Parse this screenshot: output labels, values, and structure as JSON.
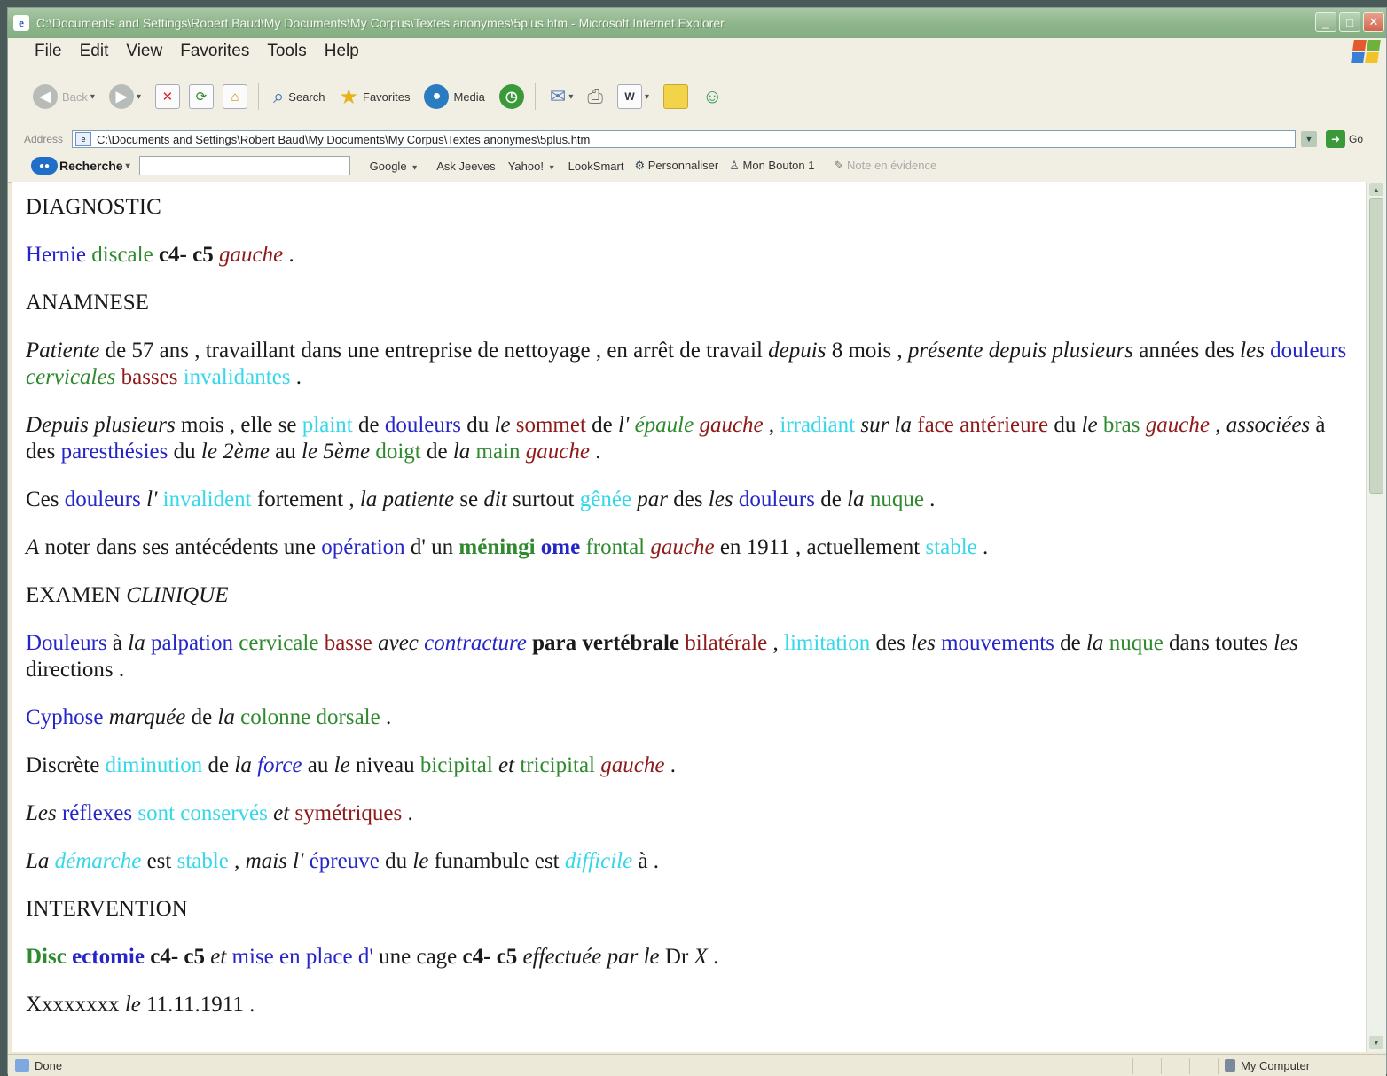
{
  "window": {
    "title": "C:\\Documents and Settings\\Robert Baud\\My Documents\\My Corpus\\Textes anonymes\\5plus.htm - Microsoft Internet Explorer"
  },
  "menu": [
    "File",
    "Edit",
    "View",
    "Favorites",
    "Tools",
    "Help"
  ],
  "toolbar": {
    "back": "Back",
    "search": "Search",
    "favorites": "Favorites",
    "media": "Media"
  },
  "address": {
    "label": "Address",
    "value": "C:\\Documents and Settings\\Robert Baud\\My Documents\\My Corpus\\Textes anonymes\\5plus.htm",
    "go": "Go"
  },
  "links": {
    "search_label": "Recherche",
    "items": [
      "Google",
      "Ask Jeeves",
      "Yahoo!",
      "LookSmart",
      "Personnaliser",
      "Mon Bouton 1",
      "Note en évidence"
    ]
  },
  "status": {
    "left": "Done",
    "zone": "My Computer"
  },
  "colors": {
    "black": "#1a1a1a",
    "blue": "#2626c8",
    "green": "#2f8a2f",
    "red": "#8e1a1a",
    "cyan": "#35d7e8"
  },
  "document": {
    "paragraphs": [
      [
        [
          "DIAGNOSTIC",
          "black",
          ""
        ]
      ],
      [
        [
          "Hernie",
          "blue",
          ""
        ],
        [
          " ",
          "black",
          ""
        ],
        [
          "discale",
          "green",
          ""
        ],
        [
          " ",
          "black",
          ""
        ],
        [
          "c4-",
          "black",
          "b"
        ],
        [
          " ",
          "black",
          ""
        ],
        [
          "c5",
          "black",
          "b"
        ],
        [
          " ",
          "black",
          ""
        ],
        [
          "gauche",
          "red",
          "i"
        ],
        [
          " .",
          "black",
          ""
        ]
      ],
      [
        [
          "ANAMNESE",
          "black",
          ""
        ]
      ],
      [
        [
          "Patiente",
          "black",
          "i"
        ],
        [
          " de 57 ans , travaillant dans une entreprise de nettoyage , en arrêt de travail ",
          "black",
          ""
        ],
        [
          "depuis",
          "black",
          "i"
        ],
        [
          " 8 mois , ",
          "black",
          ""
        ],
        [
          "présente depuis plusieurs",
          "black",
          "i"
        ],
        [
          " années des ",
          "black",
          ""
        ],
        [
          "les",
          "black",
          "i"
        ],
        [
          " ",
          "black",
          ""
        ],
        [
          "douleurs",
          "blue",
          ""
        ],
        [
          " ",
          "black",
          ""
        ],
        [
          "cervicales",
          "green",
          "i"
        ],
        [
          " ",
          "black",
          ""
        ],
        [
          "basses",
          "red",
          ""
        ],
        [
          " ",
          "black",
          ""
        ],
        [
          "invalidantes",
          "cyan",
          ""
        ],
        [
          " .",
          "black",
          ""
        ]
      ],
      [
        [
          "Depuis plusieurs",
          "black",
          "i"
        ],
        [
          " mois , elle se ",
          "black",
          ""
        ],
        [
          "plaint",
          "cyan",
          ""
        ],
        [
          " de ",
          "black",
          ""
        ],
        [
          "douleurs",
          "blue",
          ""
        ],
        [
          " du ",
          "black",
          ""
        ],
        [
          "le",
          "black",
          "i"
        ],
        [
          " ",
          "black",
          ""
        ],
        [
          "sommet",
          "red",
          ""
        ],
        [
          " de ",
          "black",
          ""
        ],
        [
          "l'",
          "black",
          "i"
        ],
        [
          " ",
          "black",
          ""
        ],
        [
          "épaule",
          "green",
          "i"
        ],
        [
          " ",
          "black",
          ""
        ],
        [
          "gauche",
          "red",
          "i"
        ],
        [
          " , ",
          "black",
          ""
        ],
        [
          "irradiant",
          "cyan",
          ""
        ],
        [
          " ",
          "black",
          ""
        ],
        [
          "sur la",
          "black",
          "i"
        ],
        [
          " ",
          "black",
          ""
        ],
        [
          "face",
          "red",
          ""
        ],
        [
          " ",
          "black",
          ""
        ],
        [
          "antérieure",
          "red",
          ""
        ],
        [
          " du ",
          "black",
          ""
        ],
        [
          "le",
          "black",
          "i"
        ],
        [
          " ",
          "black",
          ""
        ],
        [
          "bras",
          "green",
          ""
        ],
        [
          " ",
          "black",
          ""
        ],
        [
          "gauche",
          "red",
          "i"
        ],
        [
          " , ",
          "black",
          ""
        ],
        [
          "associées",
          "black",
          "i"
        ],
        [
          " à des ",
          "black",
          ""
        ],
        [
          "paresthésies",
          "blue",
          ""
        ],
        [
          " du ",
          "black",
          ""
        ],
        [
          "le 2ème",
          "black",
          "i"
        ],
        [
          " au ",
          "black",
          ""
        ],
        [
          "le 5ème",
          "black",
          "i"
        ],
        [
          " ",
          "black",
          ""
        ],
        [
          "doigt",
          "green",
          ""
        ],
        [
          " de ",
          "black",
          ""
        ],
        [
          "la",
          "black",
          "i"
        ],
        [
          " ",
          "black",
          ""
        ],
        [
          "main",
          "green",
          ""
        ],
        [
          " ",
          "black",
          ""
        ],
        [
          "gauche",
          "red",
          "i"
        ],
        [
          " .",
          "black",
          ""
        ]
      ],
      [
        [
          "Ces ",
          "black",
          ""
        ],
        [
          "douleurs",
          "blue",
          ""
        ],
        [
          " ",
          "black",
          ""
        ],
        [
          "l'",
          "black",
          "i"
        ],
        [
          " ",
          "black",
          ""
        ],
        [
          "invalident",
          "cyan",
          ""
        ],
        [
          " fortement , ",
          "black",
          ""
        ],
        [
          "la patiente",
          "black",
          "i"
        ],
        [
          " se ",
          "black",
          ""
        ],
        [
          "dit",
          "black",
          "i"
        ],
        [
          " surtout ",
          "black",
          ""
        ],
        [
          "gênée",
          "cyan",
          ""
        ],
        [
          " ",
          "black",
          ""
        ],
        [
          "par",
          "black",
          "i"
        ],
        [
          " des ",
          "black",
          ""
        ],
        [
          "les",
          "black",
          "i"
        ],
        [
          " ",
          "black",
          ""
        ],
        [
          "douleurs",
          "blue",
          ""
        ],
        [
          " de ",
          "black",
          ""
        ],
        [
          "la",
          "black",
          "i"
        ],
        [
          " ",
          "black",
          ""
        ],
        [
          "nuque",
          "green",
          ""
        ],
        [
          " .",
          "black",
          ""
        ]
      ],
      [
        [
          "A",
          "black",
          "i"
        ],
        [
          " noter dans ses antécédents une ",
          "black",
          ""
        ],
        [
          "opération",
          "blue",
          ""
        ],
        [
          " d' un ",
          "black",
          ""
        ],
        [
          "méningi",
          "green",
          "b"
        ],
        [
          " ",
          "black",
          ""
        ],
        [
          "ome",
          "blue",
          "b"
        ],
        [
          " ",
          "black",
          ""
        ],
        [
          "frontal",
          "green",
          ""
        ],
        [
          " ",
          "black",
          ""
        ],
        [
          "gauche",
          "red",
          "i"
        ],
        [
          " en 1911 , actuellement ",
          "black",
          ""
        ],
        [
          "stable",
          "cyan",
          ""
        ],
        [
          " .",
          "black",
          ""
        ]
      ],
      [
        [
          "EXAMEN ",
          "black",
          ""
        ],
        [
          "CLINIQUE",
          "black",
          "i"
        ]
      ],
      [
        [
          "Douleurs",
          "blue",
          ""
        ],
        [
          " à ",
          "black",
          ""
        ],
        [
          "la",
          "black",
          "i"
        ],
        [
          " ",
          "black",
          ""
        ],
        [
          "palpation",
          "blue",
          ""
        ],
        [
          " ",
          "black",
          ""
        ],
        [
          "cervicale",
          "green",
          ""
        ],
        [
          " ",
          "black",
          ""
        ],
        [
          "basse",
          "red",
          ""
        ],
        [
          " ",
          "black",
          ""
        ],
        [
          "avec",
          "black",
          "i"
        ],
        [
          " ",
          "black",
          ""
        ],
        [
          "contracture",
          "blue",
          "i"
        ],
        [
          " ",
          "black",
          ""
        ],
        [
          "para vertébrale",
          "black",
          "b"
        ],
        [
          " ",
          "black",
          ""
        ],
        [
          "bilatérale",
          "red",
          ""
        ],
        [
          " , ",
          "black",
          ""
        ],
        [
          "limitation",
          "cyan",
          ""
        ],
        [
          " des ",
          "black",
          ""
        ],
        [
          "les",
          "black",
          "i"
        ],
        [
          " ",
          "black",
          ""
        ],
        [
          "mouvements",
          "blue",
          ""
        ],
        [
          " de ",
          "black",
          ""
        ],
        [
          "la",
          "black",
          "i"
        ],
        [
          " ",
          "black",
          ""
        ],
        [
          "nuque",
          "green",
          ""
        ],
        [
          " dans toutes ",
          "black",
          ""
        ],
        [
          "les",
          "black",
          "i"
        ],
        [
          " directions .",
          "black",
          ""
        ]
      ],
      [
        [
          "Cyphose",
          "blue",
          ""
        ],
        [
          " ",
          "black",
          ""
        ],
        [
          "marquée",
          "black",
          "i"
        ],
        [
          " de ",
          "black",
          ""
        ],
        [
          "la",
          "black",
          "i"
        ],
        [
          " ",
          "black",
          ""
        ],
        [
          "colonne",
          "green",
          ""
        ],
        [
          " ",
          "black",
          ""
        ],
        [
          "dorsale",
          "green",
          ""
        ],
        [
          " .",
          "black",
          ""
        ]
      ],
      [
        [
          "Discrète ",
          "black",
          ""
        ],
        [
          "diminution",
          "cyan",
          ""
        ],
        [
          " de ",
          "black",
          ""
        ],
        [
          "la",
          "black",
          "i"
        ],
        [
          " ",
          "black",
          ""
        ],
        [
          "force",
          "blue",
          "i"
        ],
        [
          " au ",
          "black",
          ""
        ],
        [
          "le",
          "black",
          "i"
        ],
        [
          " niveau ",
          "black",
          ""
        ],
        [
          "bicipital",
          "green",
          ""
        ],
        [
          " ",
          "black",
          ""
        ],
        [
          "et",
          "black",
          "i"
        ],
        [
          " ",
          "black",
          ""
        ],
        [
          "tricipital",
          "green",
          ""
        ],
        [
          " ",
          "black",
          ""
        ],
        [
          "gauche",
          "red",
          "i"
        ],
        [
          " .",
          "black",
          ""
        ]
      ],
      [
        [
          "Les",
          "black",
          "i"
        ],
        [
          " ",
          "black",
          ""
        ],
        [
          "réflexes",
          "blue",
          ""
        ],
        [
          " ",
          "black",
          ""
        ],
        [
          "sont conservés",
          "cyan",
          ""
        ],
        [
          " ",
          "black",
          ""
        ],
        [
          "et",
          "black",
          "i"
        ],
        [
          " ",
          "black",
          ""
        ],
        [
          "symétriques",
          "red",
          ""
        ],
        [
          " .",
          "black",
          ""
        ]
      ],
      [
        [
          "La",
          "black",
          "i"
        ],
        [
          " ",
          "black",
          ""
        ],
        [
          "démarche",
          "cyan",
          "i"
        ],
        [
          " est ",
          "black",
          ""
        ],
        [
          "stable",
          "cyan",
          ""
        ],
        [
          " , ",
          "black",
          ""
        ],
        [
          "mais l'",
          "black",
          "i"
        ],
        [
          " ",
          "black",
          ""
        ],
        [
          "épreuve",
          "blue",
          ""
        ],
        [
          " du ",
          "black",
          ""
        ],
        [
          "le",
          "black",
          "i"
        ],
        [
          " funambule est ",
          "black",
          ""
        ],
        [
          "difficile",
          "cyan",
          "i"
        ],
        [
          " à .",
          "black",
          ""
        ]
      ],
      [
        [
          "INTERVENTION",
          "black",
          ""
        ]
      ],
      [
        [
          "Disc",
          "green",
          "b"
        ],
        [
          " ",
          "black",
          ""
        ],
        [
          "ectomie",
          "blue",
          "b"
        ],
        [
          " ",
          "black",
          ""
        ],
        [
          "c4-",
          "black",
          "b"
        ],
        [
          " ",
          "black",
          ""
        ],
        [
          "c5",
          "black",
          "b"
        ],
        [
          " ",
          "black",
          ""
        ],
        [
          "et",
          "black",
          "i"
        ],
        [
          " ",
          "black",
          ""
        ],
        [
          "mise en place",
          "blue",
          ""
        ],
        [
          " ",
          "black",
          ""
        ],
        [
          "d'",
          "blue",
          ""
        ],
        [
          " une cage ",
          "black",
          ""
        ],
        [
          "c4-",
          "black",
          "b"
        ],
        [
          " ",
          "black",
          ""
        ],
        [
          "c5",
          "black",
          "b"
        ],
        [
          " ",
          "black",
          ""
        ],
        [
          "effectuée par",
          "black",
          "i"
        ],
        [
          " ",
          "black",
          ""
        ],
        [
          "le",
          "black",
          "i"
        ],
        [
          " Dr ",
          "black",
          ""
        ],
        [
          "X",
          "black",
          "i"
        ],
        [
          " .",
          "black",
          ""
        ]
      ],
      [
        [
          "Xxxxxxxx ",
          "black",
          ""
        ],
        [
          "le",
          "black",
          "i"
        ],
        [
          " 11.11.1911 .",
          "black",
          ""
        ]
      ]
    ]
  }
}
